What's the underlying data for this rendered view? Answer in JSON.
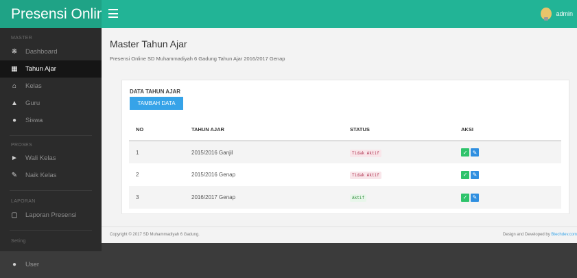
{
  "app": {
    "title": "Presensi Online"
  },
  "topbar": {
    "user": "admin",
    "menu_icon": "hamburger-icon"
  },
  "sidebar": {
    "sections": [
      {
        "label": "MASTER",
        "items": [
          {
            "label": "Dashboard",
            "icon": "dashboard-icon"
          },
          {
            "label": "Tahun Ajar",
            "icon": "calendar-icon",
            "active": true
          },
          {
            "label": "Kelas",
            "icon": "home-icon"
          },
          {
            "label": "Guru",
            "icon": "graduation-cap-icon"
          },
          {
            "label": "Siswa",
            "icon": "user-icon"
          }
        ]
      },
      {
        "label": "PROSES",
        "items": [
          {
            "label": "Wali Kelas",
            "icon": "volume-icon"
          },
          {
            "label": "Naik Kelas",
            "icon": "edit-icon"
          }
        ]
      },
      {
        "label": "LAPORAN",
        "items": [
          {
            "label": "Laporan Presensi",
            "icon": "file-icon"
          }
        ]
      },
      {
        "label": "Seting",
        "items": [
          {
            "label": "User",
            "icon": "user-icon"
          }
        ]
      }
    ]
  },
  "main": {
    "title": "Master Tahun Ajar",
    "subtitle": "Presensi Online SD Muhammadiyah 6 Gadung Tahun Ajar 2016/2017 Genap",
    "card_title": "DATA TAHUN AJAR",
    "add_button": "TAMBAH DATA",
    "table": {
      "headers": [
        "NO",
        "TAHUN AJAR",
        "STATUS",
        "AKSI"
      ],
      "rows": [
        {
          "no": "1",
          "tahun": "2015/2016 Ganjil",
          "status": "Tidak Aktif",
          "active": false
        },
        {
          "no": "2",
          "tahun": "2015/2016 Genap",
          "status": "Tidak Aktif",
          "active": false
        },
        {
          "no": "3",
          "tahun": "2016/2017 Genap",
          "status": "Aktif",
          "active": true
        }
      ]
    }
  },
  "footer": {
    "copyright": "Copyright © 2017 SD Muhammadiyah 6 Gadung.",
    "credit_prefix": "Design and Developed by ",
    "credit_link": "Btechdev.com"
  },
  "colors": {
    "brand": "#1fa386",
    "topbar": "#22b496",
    "button": "#36a3e8",
    "sidebar": "#2b2b2b"
  }
}
